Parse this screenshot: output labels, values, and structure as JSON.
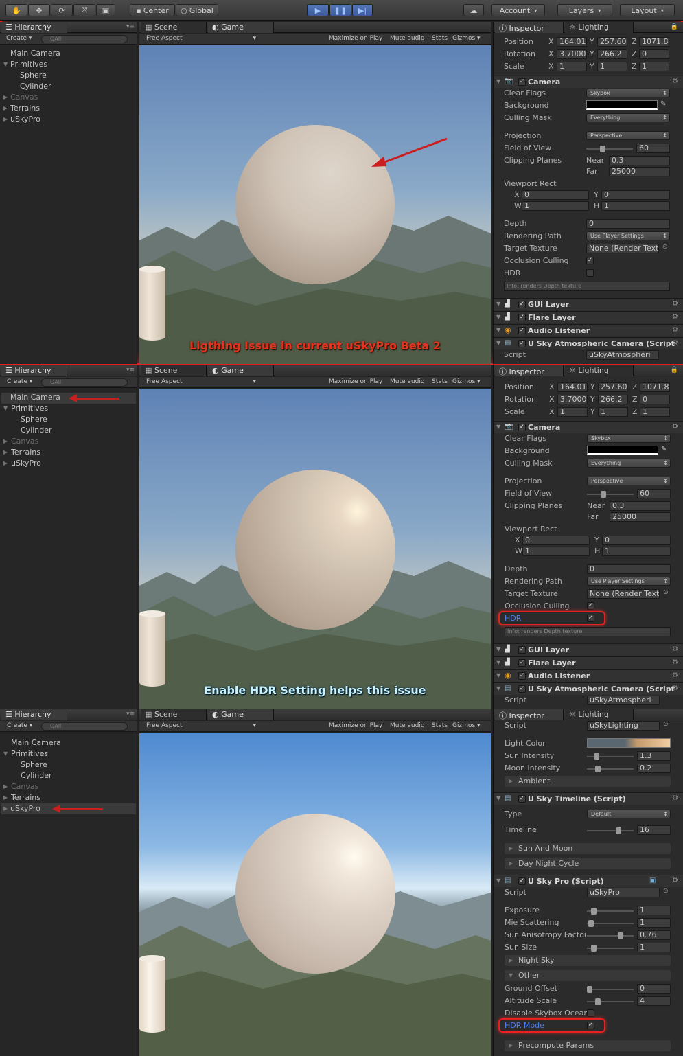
{
  "toolbar": {
    "center": "Center",
    "global": "Global",
    "account": "Account",
    "layers": "Layers",
    "layout": "Layout"
  },
  "hierarchy": {
    "title": "Hierarchy",
    "create": "Create",
    "search": "All",
    "items": [
      "Main Camera",
      "Primitives",
      "Sphere",
      "Cylinder",
      "Canvas",
      "Terrains",
      "uSkyPro"
    ]
  },
  "view": {
    "scene_tab": "Scene",
    "game_tab": "Game",
    "aspect": "Free Aspect",
    "maximize": "Maximize on Play",
    "mute": "Mute audio",
    "stats": "Stats",
    "gizmos": "Gizmos"
  },
  "inspector": {
    "title": "Inspector",
    "lighting_tab": "Lighting"
  },
  "transform": {
    "position_label": "Position",
    "rotation_label": "Rotation",
    "scale_label": "Scale",
    "pos": [
      "164.01",
      "257.60",
      "1071.8"
    ],
    "rot": [
      "3.7000",
      "266.2",
      "0"
    ],
    "scale": [
      "1",
      "1",
      "1"
    ],
    "axes": [
      "X",
      "Y",
      "Z"
    ]
  },
  "camera": {
    "name": "Camera",
    "clear_flags": "Clear Flags",
    "clear_flags_val": "Skybox",
    "background": "Background",
    "culling_mask": "Culling Mask",
    "culling_val": "Everything",
    "projection": "Projection",
    "projection_val": "Perspective",
    "fov": "Field of View",
    "fov_val": "60",
    "clipping": "Clipping Planes",
    "near": "Near",
    "near_val": "0.3",
    "far": "Far",
    "far_val": "25000",
    "viewport": "Viewport Rect",
    "vx": "0",
    "vy": "0",
    "vw": "1",
    "vh": "1",
    "x": "X",
    "y": "Y",
    "w": "W",
    "h": "H",
    "depth": "Depth",
    "depth_val": "0",
    "render_path": "Rendering Path",
    "render_path_val": "Use Player Settings",
    "target": "Target Texture",
    "target_val": "None (Render Text",
    "occlusion": "Occlusion Culling",
    "hdr": "HDR",
    "info": "Info: renders Depth texture"
  },
  "components": {
    "gui": "GUI Layer",
    "flare": "Flare Layer",
    "audio": "Audio Listener",
    "atmos": "U Sky Atmospheric Camera (Script",
    "script": "Script",
    "script_val": "uSkyAtmospheri"
  },
  "captions": {
    "p1": "Ligthing Issue in current uSkyPro Beta 2",
    "p2": "Enable HDR Setting helps this issue"
  },
  "p3": {
    "script": "Script",
    "script_val": "uSkyLighting",
    "light_color": "Light Color",
    "sun_int": "Sun Intensity",
    "sun_int_val": "1.3",
    "moon_int": "Moon Intensity",
    "moon_int_val": "0.2",
    "ambient": "Ambient",
    "timeline_comp": "U Sky Timeline (Script)",
    "type": "Type",
    "type_val": "Default",
    "timeline": "Timeline",
    "timeline_val": "16",
    "sun_moon": "Sun And Moon",
    "day_night": "Day Night Cycle",
    "skypro": "U Sky Pro (Script)",
    "skypro_script": "uSkyPro",
    "exposure": "Exposure",
    "exposure_val": "1",
    "mie": "Mie Scattering",
    "mie_val": "1",
    "aniso": "Sun Anisotropy Factor",
    "aniso_val": "0.76",
    "sun_size": "Sun Size",
    "sun_size_val": "1",
    "night_sky": "Night Sky",
    "other": "Other",
    "ground_offset": "Ground Offset",
    "ground_offset_val": "0",
    "altitude": "Altitude Scale",
    "altitude_val": "4",
    "disable_ocean": "Disable Skybox Ocean",
    "hdr_mode": "HDR Mode",
    "precompute": "Precompute Params"
  }
}
